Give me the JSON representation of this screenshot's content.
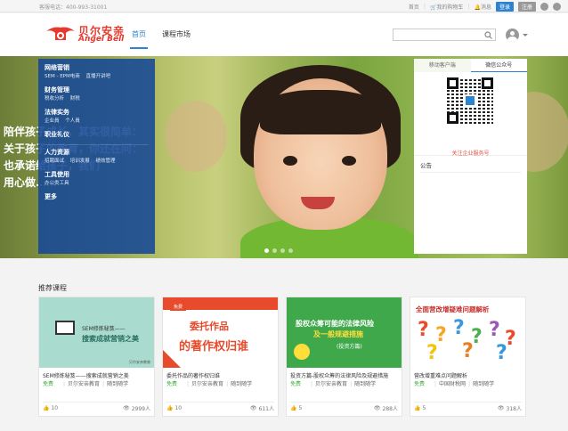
{
  "topbar": {
    "phone": "客服电话：400-993-31001",
    "home": "首页",
    "cart": "我的购物车",
    "messages": "消息",
    "login": "登录",
    "register": "注册"
  },
  "header": {
    "logo_cn": "贝尔安亲",
    "logo_en": "Angel Bell",
    "nav": [
      {
        "label": "首页",
        "active": true
      },
      {
        "label": "课程市场",
        "active": false
      }
    ],
    "search_placeholder": ""
  },
  "banner": {
    "headline_lines": [
      "陪伴孩子成长，其实很简单：",
      "关于孩子的教育，你还在问：",
      "也承诺给孩子，我们",
      "用心做……"
    ]
  },
  "categories": [
    {
      "title": "网络营销",
      "subs": [
        "SEM - EPM电商",
        "直播开讲吧"
      ]
    },
    {
      "title": "财务管理",
      "subs": [
        "税收分析",
        "财税"
      ]
    },
    {
      "title": "法律实务",
      "subs": [
        "企业員",
        "个人員"
      ]
    },
    {
      "title": "职业礼仪",
      "subs": []
    },
    {
      "title": "人力资源",
      "subs": [
        "招聘面试",
        "培训发展",
        "绩效管理"
      ]
    },
    {
      "title": "工具使用",
      "subs": [
        "办公类工具"
      ]
    },
    {
      "title": "更多",
      "subs": []
    }
  ],
  "right_panel": {
    "tabs": [
      {
        "label": "移动客户端",
        "active": false
      },
      {
        "label": "微信公众号",
        "active": true
      }
    ],
    "qr_caption": "关注企业服务号",
    "notice_title": "公告"
  },
  "recommended": {
    "title": "推荐课程",
    "courses": [
      {
        "thumb_line1": "SEM修炼秘笈——",
        "thumb_line2": "搜索成就营销之美",
        "thumb_publisher": "贝尔安亲教育",
        "title": "SEM修炼秘笈——搜索成就营销之美",
        "price": "免费",
        "provider": "贝尔安亲教育",
        "mode": "随到随学",
        "likes": "10",
        "learners": "2999人"
      },
      {
        "thumb_tag": "免费",
        "thumb_line1": "委托作品",
        "thumb_line2": "的著作权归谁",
        "title": "委托作品的著作权归谁",
        "price": "免费",
        "provider": "贝尔安亲教育",
        "mode": "随到随学",
        "likes": "10",
        "learners": "611人"
      },
      {
        "thumb_line1": "股权众筹可能的法律风险",
        "thumb_line2": "及一般规避措施",
        "thumb_line3": "(投资方篇)",
        "title": "投资方篇-股权众筹的法律风险及规避措施",
        "price": "免费",
        "provider": "贝尔安亲教育",
        "mode": "随到随学",
        "likes": "5",
        "learners": "288人"
      },
      {
        "thumb_line1": "全面营改增疑难问题解析",
        "title": "营改增重难点问题解析",
        "price": "免费",
        "provider": "中国财税网",
        "mode": "随到随学",
        "likes": "5",
        "learners": "318人"
      }
    ]
  },
  "colors": {
    "accent": "#2d83cf",
    "logo": "#e63a2f",
    "menu": "#164896",
    "free": "#3eb03e"
  }
}
